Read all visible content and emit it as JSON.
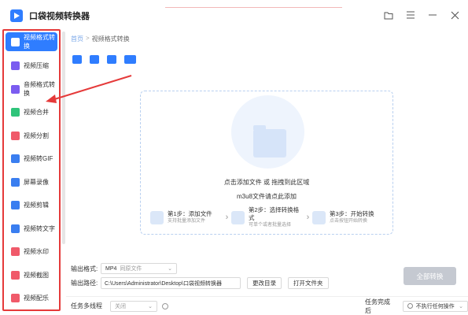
{
  "app": {
    "title": "口袋视频转换器",
    "logo_icon": "play-logo-icon"
  },
  "window_controls": [
    {
      "name": "folder-icon",
      "glyph": "🗀"
    },
    {
      "name": "menu-icon",
      "glyph": "≡"
    },
    {
      "name": "minimize-icon",
      "glyph": "—"
    },
    {
      "name": "close-icon",
      "glyph": "✕"
    }
  ],
  "sidebar": {
    "highlight_color": "#e53a3a",
    "items": [
      {
        "label": "视频格式转换",
        "icon": "video-convert-icon",
        "color": "#2f7dff",
        "active": true
      },
      {
        "label": "视频压缩",
        "icon": "compress-icon",
        "color": "#7b5cf0"
      },
      {
        "label": "音频格式转换",
        "icon": "audio-icon",
        "color": "#7b5cf0"
      },
      {
        "label": "视频合并",
        "icon": "merge-icon",
        "color": "#2fc47a"
      },
      {
        "label": "视频分割",
        "icon": "split-icon",
        "color": "#f05a6a"
      },
      {
        "label": "视频转GIF",
        "icon": "gif-icon",
        "color": "#3a7ef0"
      },
      {
        "label": "屏幕录像",
        "icon": "record-icon",
        "color": "#3a7ef0"
      },
      {
        "label": "视频剪辑",
        "icon": "edit-icon",
        "color": "#3a7ef0"
      },
      {
        "label": "视频转文字",
        "icon": "text-icon",
        "color": "#3a7ef0"
      },
      {
        "label": "视频水印",
        "icon": "watermark-icon",
        "color": "#f05a6a"
      },
      {
        "label": "视频截图",
        "icon": "screenshot-icon",
        "color": "#f05a6a"
      },
      {
        "label": "视频配乐",
        "icon": "music-icon",
        "color": "#f05a6a"
      }
    ]
  },
  "breadcrumb": {
    "home": "首页",
    "separator": ">",
    "current": "视频格式转换"
  },
  "toolbar": [
    "add-file-icon",
    "add-folder-icon",
    "clear-icon",
    "m3u8-icon"
  ],
  "dropzone": {
    "line1": "点击添加文件 或 拖拽到此区域",
    "line2": "m3u8文件请点此添加",
    "steps": [
      {
        "title": "第1步：添加文件",
        "sub": "支持批量添加文件"
      },
      {
        "title": "第2步：选择转换格式",
        "sub": "可单个或者批量选择"
      },
      {
        "title": "第3步：开始转换",
        "sub": "点击按钮开始转换"
      }
    ]
  },
  "output": {
    "format_label": "输出格式:",
    "format_value": "MP4",
    "format_quality": "同原文件",
    "path_label": "输出路径:",
    "path_value": "C:\\Users\\Administrator\\Desktop\\口袋视频转换器",
    "change_dir": "更改目录",
    "open_folder": "打开文件夹",
    "convert_all": "全部转换"
  },
  "bottom": {
    "multithread_label": "任务多线程",
    "multithread_value": "关闭",
    "after_done_label": "任务完成后",
    "after_done_value": "不执行任何操作"
  }
}
